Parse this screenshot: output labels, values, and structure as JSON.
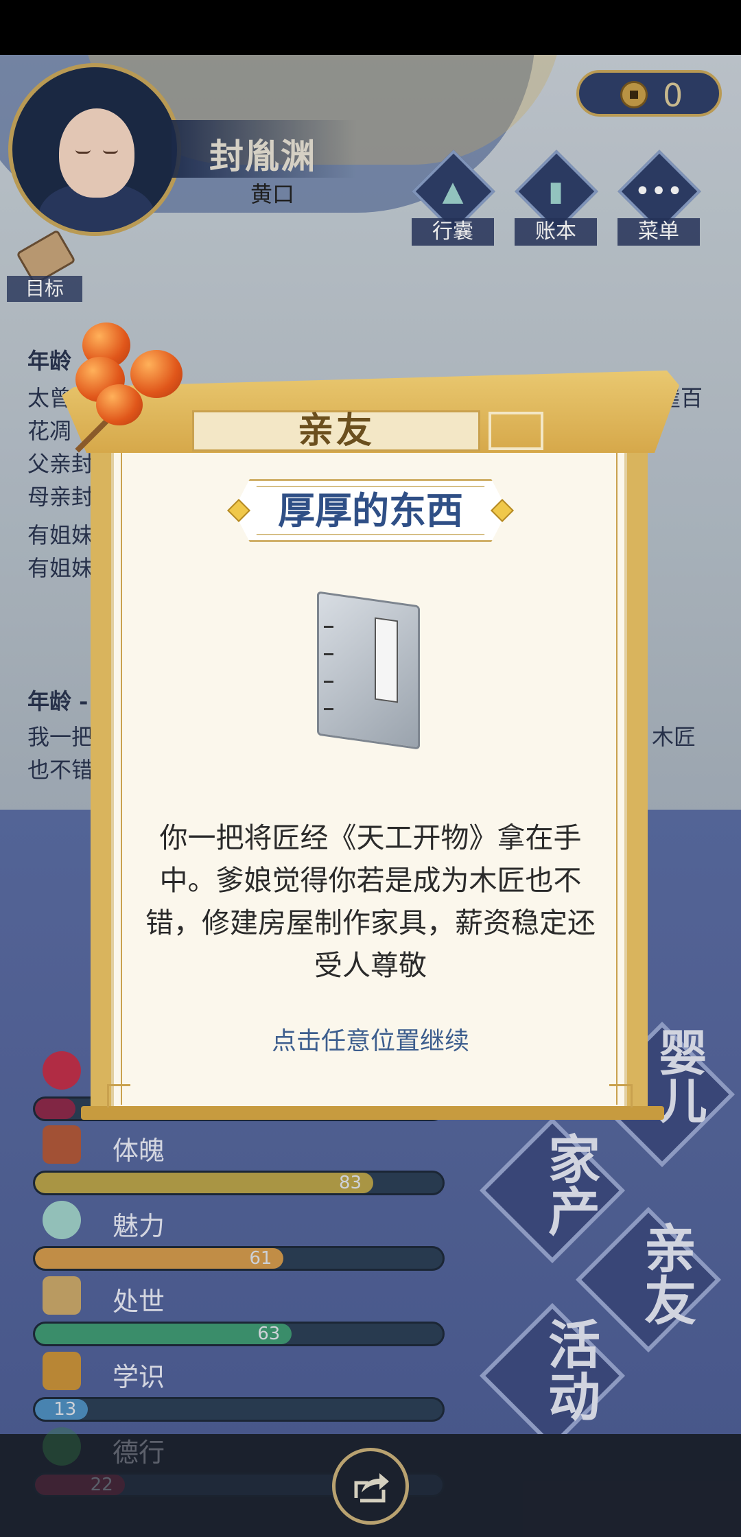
{
  "player": {
    "name": "封胤渊",
    "title": "黄口"
  },
  "currency": {
    "value": "0",
    "icon": "copper-coin-icon"
  },
  "top_menu": [
    {
      "label": "行囊",
      "icon": "bag-icon"
    },
    {
      "label": "账本",
      "icon": "ledger-icon"
    },
    {
      "label": "菜单",
      "icon": "more-icon"
    }
  ],
  "target": {
    "label": "目标",
    "icon": "scroll-icon"
  },
  "log": {
    "line1": "年龄",
    "line2": "太曾",
    "line2_right": "崖百",
    "line3": "花凋",
    "line4": "父亲封",
    "line5": "母亲封",
    "line6": "有姐妹",
    "line7": "有姐妹",
    "line8": "年龄 -",
    "line9": "我一把",
    "line9_right": "木匠",
    "line10": "也不错"
  },
  "actions": [
    {
      "label": "婴儿"
    },
    {
      "label": "家产"
    },
    {
      "label": "亲友"
    },
    {
      "label": "活动"
    }
  ],
  "stats": [
    {
      "label": "体魄",
      "value": "83",
      "percent": 83,
      "color": "#b8a24a",
      "icon": "physique-icon"
    },
    {
      "label": "魅力",
      "value": "61",
      "percent": 61,
      "color": "#d29a4c",
      "icon": "charm-icon"
    },
    {
      "label": "处世",
      "value": "63",
      "percent": 63,
      "color": "#3f9a74",
      "icon": "worldly-icon"
    },
    {
      "label": "学识",
      "value": "13",
      "percent": 13,
      "color": "#4f8fbf",
      "icon": "knowledge-icon"
    },
    {
      "label": "德行",
      "value": "22",
      "percent": 22,
      "color": "#8c2a4a",
      "icon": "virtue-icon"
    }
  ],
  "dialog": {
    "header": "亲友",
    "subtitle": "厚厚的东西",
    "item_icon": "book-icon",
    "body": "你一把将匠经《天工开物》拿在手中。爹娘觉得你若是成为木匠也不错，修建房屋制作家具，薪资稳定还受人尊敬",
    "hint": "点击任意位置继续"
  },
  "share": {
    "icon": "share-icon"
  }
}
